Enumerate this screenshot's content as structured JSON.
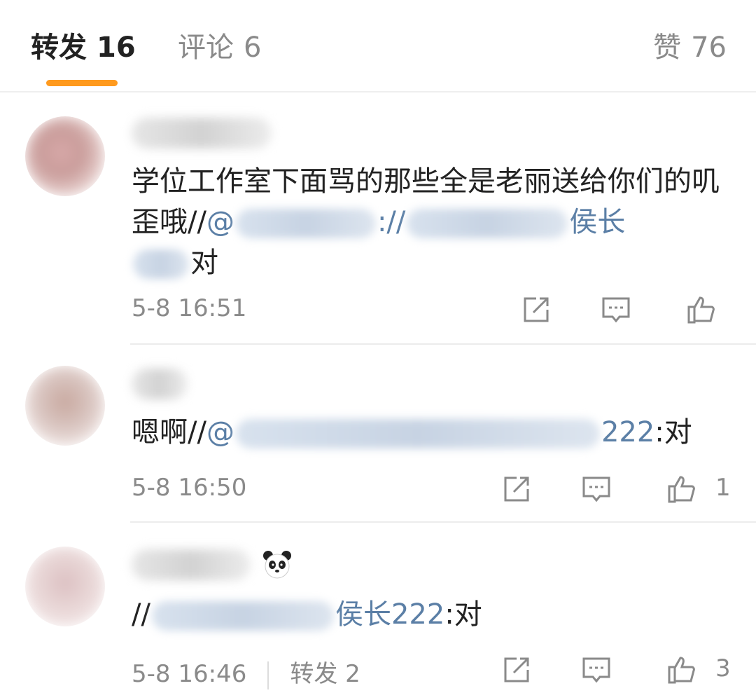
{
  "tabs": {
    "repost_label": "转发",
    "repost_count": "16",
    "comment_label": "评论",
    "comment_count": "6",
    "like_label": "赞",
    "like_count": "76"
  },
  "accent_color": "#ff9a1e",
  "mention_color": "#5b7fa6",
  "reposts": [
    {
      "content_lead": "学位工作室下面骂的那些全是老丽送给你们的叽歪哦//",
      "mention_prefix": "@",
      "mention_prefix2": "://",
      "mention_tail": "侯长",
      "content_end": "对",
      "time": "5-8 16:51",
      "like_count": ""
    },
    {
      "content_lead": "嗯啊//",
      "mention_prefix": "@",
      "mention_tail": "222",
      "content_end": ":对",
      "time": "5-8 16:50",
      "like_count": "1"
    },
    {
      "content_lead": "//",
      "mention_tail": "侯长222",
      "content_end": ":对",
      "time": "5-8 16:46",
      "repost_label": "转发 2",
      "like_count": "3",
      "emoji": "panda-icon"
    }
  ]
}
